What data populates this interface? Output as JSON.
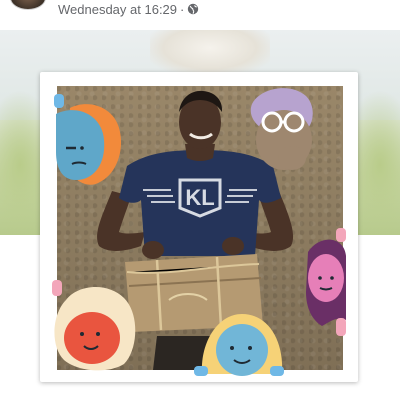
{
  "post": {
    "timestamp": "Wednesday at 16:29",
    "separator": "·",
    "privacy_icon": "globe-icon"
  },
  "photo": {
    "shirt_logo": "KL"
  },
  "stickers": [
    {
      "name": "orange-hair-face-sticker",
      "color": "#5fa7c9"
    },
    {
      "name": "glasses-face-sticker",
      "color": "#b7a3cf"
    },
    {
      "name": "pink-face-sticker",
      "color": "#e67fb8"
    },
    {
      "name": "red-face-sticker",
      "color": "#e9553f"
    },
    {
      "name": "blonde-face-sticker",
      "color": "#71b6d7"
    }
  ],
  "colors": {
    "timestamp_text": "#65676b",
    "frame": "#ffffff",
    "ground": "#8e7d61"
  }
}
